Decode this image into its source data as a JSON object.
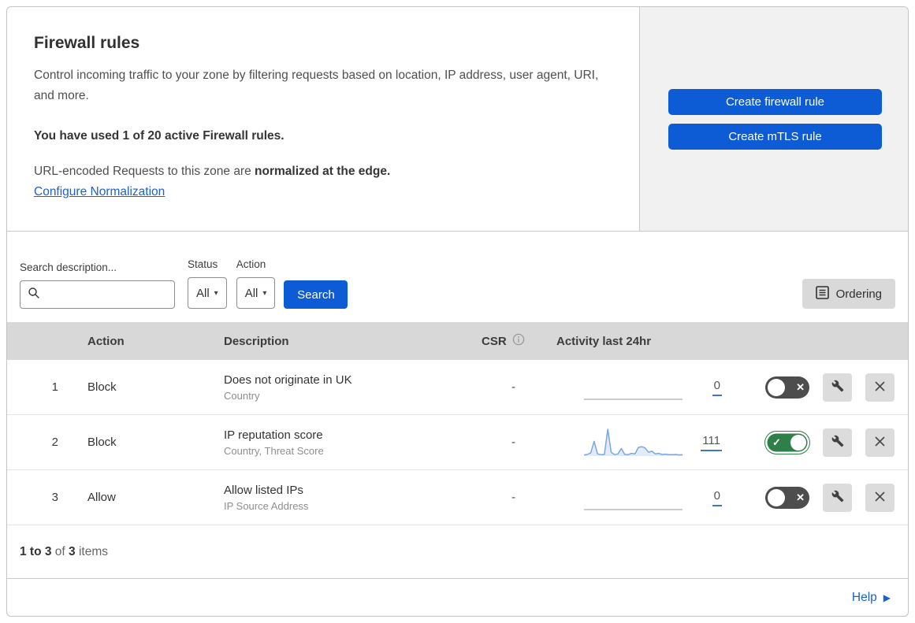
{
  "header": {
    "title": "Firewall rules",
    "description": "Control incoming traffic to your zone by filtering requests based on location, IP address, user agent, URI, and more.",
    "usage_line": "You have used 1 of 20 active Firewall rules.",
    "normalization_text": "URL-encoded Requests to this zone are ",
    "normalization_bold": "normalized at the edge.",
    "normalization_link": "Configure Normalization",
    "create_firewall_button": "Create firewall rule",
    "create_mtls_button": "Create mTLS rule"
  },
  "filters": {
    "search_label": "Search description...",
    "search_placeholder": "",
    "status_label": "Status",
    "status_value": "All",
    "action_label": "Action",
    "action_value": "All",
    "search_button": "Search",
    "ordering_button": "Ordering"
  },
  "table": {
    "headers": {
      "action": "Action",
      "description": "Description",
      "csr": "CSR",
      "activity": "Activity last 24hr"
    },
    "rows": [
      {
        "priority": "1",
        "action": "Block",
        "description": "Does not originate in UK",
        "fields": "Country",
        "csr": "-",
        "activity_count": "0",
        "enabled": false,
        "sparkline": []
      },
      {
        "priority": "2",
        "action": "Block",
        "description": "IP reputation score",
        "fields": "Country, Threat Score",
        "csr": "-",
        "activity_count": "111",
        "enabled": true,
        "sparkline": [
          4,
          6,
          12,
          55,
          8,
          5,
          6,
          100,
          14,
          5,
          8,
          28,
          6,
          5,
          10,
          8,
          32,
          35,
          30,
          14,
          18,
          8,
          10,
          6,
          7,
          5,
          5,
          6,
          4,
          5
        ]
      },
      {
        "priority": "3",
        "action": "Allow",
        "description": "Allow listed IPs",
        "fields": "IP Source Address",
        "csr": "-",
        "activity_count": "0",
        "enabled": false,
        "sparkline": []
      }
    ]
  },
  "footer": {
    "range": "1 to 3",
    "of_label": "of",
    "total": "3",
    "items_label": "items",
    "help_label": "Help"
  },
  "icons": {
    "caret_down": "▾",
    "check": "✓",
    "cross": "✕",
    "arrow_right": "▶"
  },
  "colors": {
    "accent_blue": "#0d5cd5",
    "link_blue": "#2061c9",
    "toggle_green": "#2e8048",
    "toggle_off_gray": "#4d4d4d",
    "header_gray": "#d8d8d8",
    "panel_gray": "#f1f1f2",
    "sparkline_blue": "#7aa7e0"
  }
}
